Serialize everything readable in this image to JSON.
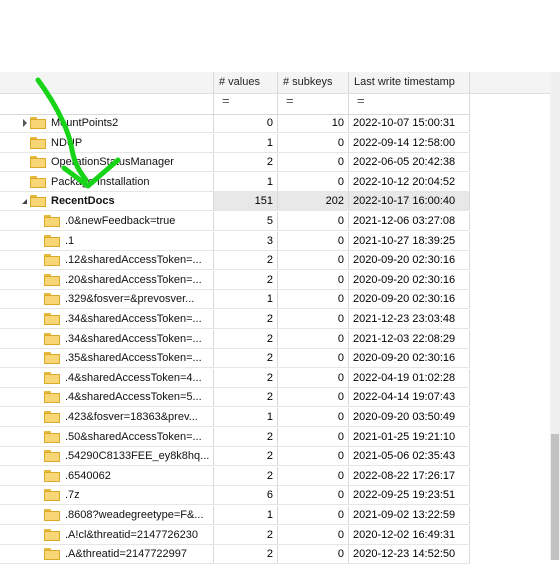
{
  "columns": {
    "values": "# values",
    "subkeys": "# subkeys",
    "timestamp": "Last write timestamp",
    "filter_symbol": "="
  },
  "rows": [
    {
      "name": "MountPoints2",
      "values": "0",
      "subkeys": "10",
      "timestamp": "2022-10-07 15:00:31",
      "level": 0,
      "expander": "right"
    },
    {
      "name": "NDUP",
      "values": "1",
      "subkeys": "0",
      "timestamp": "2022-09-14 12:58:00",
      "level": 0,
      "expander": "none"
    },
    {
      "name": "OperationStatusManager",
      "values": "2",
      "subkeys": "0",
      "timestamp": "2022-06-05 20:42:38",
      "level": 0,
      "expander": "none"
    },
    {
      "name": "Package Installation",
      "values": "1",
      "subkeys": "0",
      "timestamp": "2022-10-12 20:04:52",
      "level": 0,
      "expander": "none"
    },
    {
      "name": "RecentDocs",
      "values": "151",
      "subkeys": "202",
      "timestamp": "2022-10-17 16:00:40",
      "level": 0,
      "expander": "down",
      "selected": true
    },
    {
      "name": ".0&newFeedback=true",
      "values": "5",
      "subkeys": "0",
      "timestamp": "2021-12-06 03:27:08",
      "level": 1
    },
    {
      "name": ".1",
      "values": "3",
      "subkeys": "0",
      "timestamp": "2021-10-27 18:39:25",
      "level": 1
    },
    {
      "name": ".12&sharedAccessToken=...",
      "values": "2",
      "subkeys": "0",
      "timestamp": "2020-09-20 02:30:16",
      "level": 1
    },
    {
      "name": ".20&sharedAccessToken=...",
      "values": "2",
      "subkeys": "0",
      "timestamp": "2020-09-20 02:30:16",
      "level": 1
    },
    {
      "name": ".329&fosver=&prevosver...",
      "values": "1",
      "subkeys": "0",
      "timestamp": "2020-09-20 02:30:16",
      "level": 1
    },
    {
      "name": ".34&sharedAccessToken=...",
      "values": "2",
      "subkeys": "0",
      "timestamp": "2021-12-23 23:03:48",
      "level": 1
    },
    {
      "name": ".34&sharedAccessToken=...",
      "values": "2",
      "subkeys": "0",
      "timestamp": "2021-12-03 22:08:29",
      "level": 1
    },
    {
      "name": ".35&sharedAccessToken=...",
      "values": "2",
      "subkeys": "0",
      "timestamp": "2020-09-20 02:30:16",
      "level": 1
    },
    {
      "name": ".4&sharedAccessToken=4...",
      "values": "2",
      "subkeys": "0",
      "timestamp": "2022-04-19 01:02:28",
      "level": 1
    },
    {
      "name": ".4&sharedAccessToken=5...",
      "values": "2",
      "subkeys": "0",
      "timestamp": "2022-04-14 19:07:43",
      "level": 1
    },
    {
      "name": ".423&fosver=18363&prev...",
      "values": "1",
      "subkeys": "0",
      "timestamp": "2020-09-20 03:50:49",
      "level": 1
    },
    {
      "name": ".50&sharedAccessToken=...",
      "values": "2",
      "subkeys": "0",
      "timestamp": "2021-01-25 19:21:10",
      "level": 1
    },
    {
      "name": ".54290C8133FEE_ey8k8hq...",
      "values": "2",
      "subkeys": "0",
      "timestamp": "2021-05-06 02:35:43",
      "level": 1
    },
    {
      "name": ".6540062",
      "values": "2",
      "subkeys": "0",
      "timestamp": "2022-08-22 17:26:17",
      "level": 1
    },
    {
      "name": ".7z",
      "values": "6",
      "subkeys": "0",
      "timestamp": "2022-09-25 19:23:51",
      "level": 1
    },
    {
      "name": ".8608?weadegreetype=F&...",
      "values": "1",
      "subkeys": "0",
      "timestamp": "2021-09-02 13:22:59",
      "level": 1
    },
    {
      "name": ".A!cl&threatid=2147726230",
      "values": "2",
      "subkeys": "0",
      "timestamp": "2020-12-02 16:49:31",
      "level": 1
    },
    {
      "name": ".A&threatid=2147722997",
      "values": "2",
      "subkeys": "0",
      "timestamp": "2020-12-23 14:52:50",
      "level": 1
    }
  ],
  "colors": {
    "annotation_arrow": "#18d418",
    "folder": "#f8d675",
    "selected_row": "#e8e8e8"
  },
  "icons": {
    "folder": "folder-icon",
    "expand_collapsed": "chevron-right-icon",
    "expand_expanded": "chevron-down-icon"
  }
}
